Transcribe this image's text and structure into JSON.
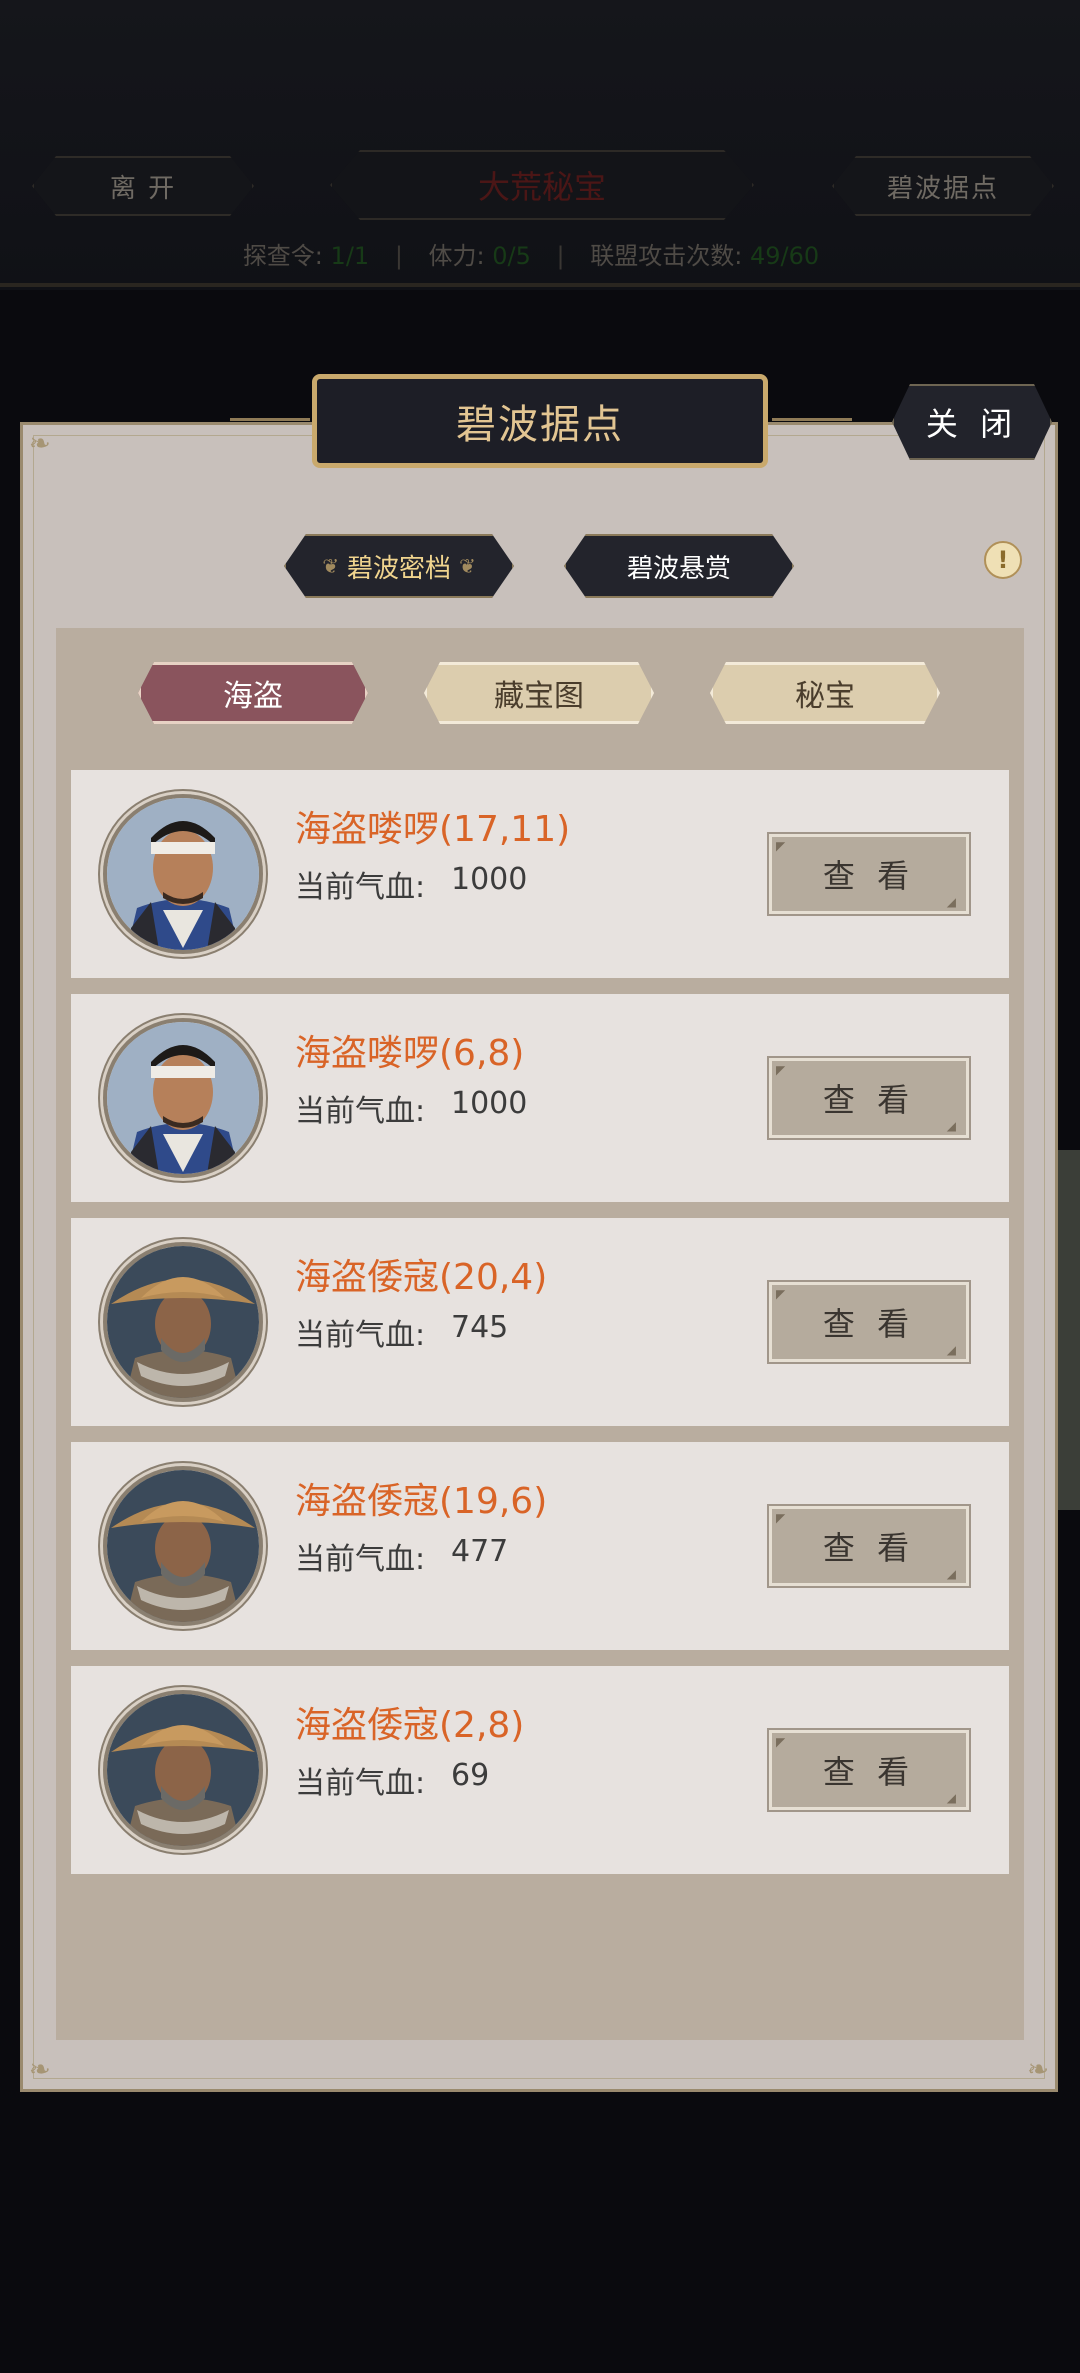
{
  "hud": {
    "leave_label": "离 开",
    "title": "大荒秘宝",
    "location_label": "碧波据点",
    "stats": [
      {
        "label": "探查令:",
        "value": "1/1"
      },
      {
        "label": "体力:",
        "value": "0/5"
      },
      {
        "label": "联盟攻击次数:",
        "value": "49/60"
      }
    ]
  },
  "panel": {
    "title": "碧波据点",
    "close_label": "关 闭",
    "subtabs": [
      "碧波密档",
      "碧波悬赏"
    ],
    "info_icon": "!",
    "categories": [
      {
        "label": "海盗",
        "active": true
      },
      {
        "label": "藏宝图",
        "active": false
      },
      {
        "label": "秘宝",
        "active": false
      }
    ],
    "hp_label": "当前气血:",
    "view_label": "查 看",
    "rows": [
      {
        "name": "海盗喽啰(17,11)",
        "hp": "1000",
        "portrait": "bandana-pirate"
      },
      {
        "name": "海盗喽啰(6,8)",
        "hp": "1000",
        "portrait": "bandana-pirate"
      },
      {
        "name": "海盗倭寇(20,4)",
        "hp": "745",
        "portrait": "straw-hat-pirate"
      },
      {
        "name": "海盗倭寇(19,6)",
        "hp": "477",
        "portrait": "straw-hat-pirate"
      },
      {
        "name": "海盗倭寇(2,8)",
        "hp": "69",
        "portrait": "straw-hat-pirate"
      }
    ]
  },
  "colors": {
    "name_orange": "#d96427",
    "active_tab": "#8a545d",
    "gold": "#c9a96c"
  }
}
